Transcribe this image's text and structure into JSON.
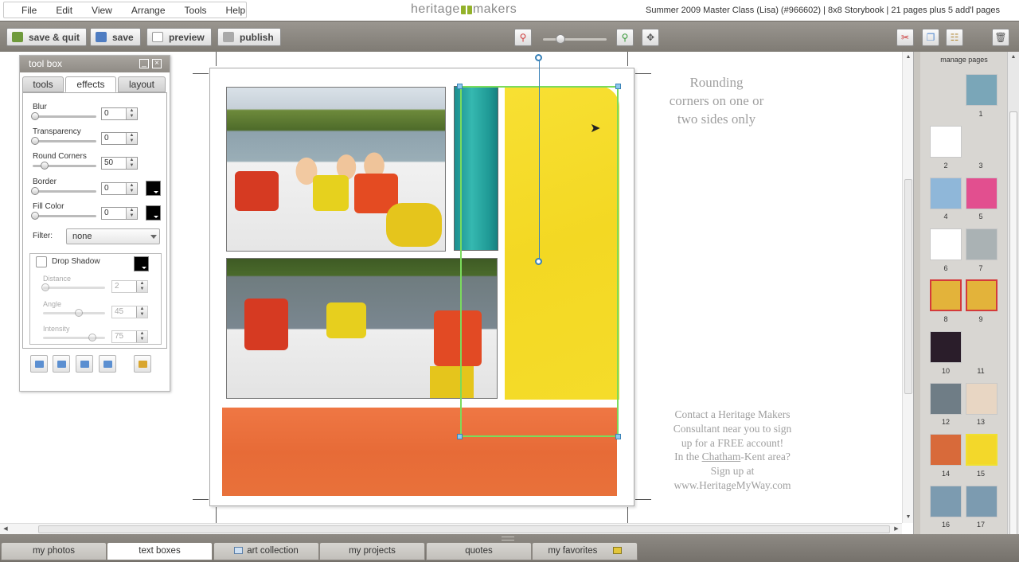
{
  "menu": {
    "items": [
      "File",
      "Edit",
      "View",
      "Arrange",
      "Tools",
      "Help"
    ]
  },
  "logo": {
    "left": "heritage",
    "right": "makers"
  },
  "project_info": "Summer 2009 Master Class (Lisa) (#966602) | 8x8 Storybook | 21 pages plus 5 add'l pages",
  "toolbar": {
    "save_quit": "save & quit",
    "save": "save",
    "preview": "preview",
    "publish": "publish"
  },
  "toolbox": {
    "title": "tool box",
    "tabs": [
      "tools",
      "effects",
      "layout"
    ],
    "active_tab": "effects",
    "blur": {
      "label": "Blur",
      "value": "0"
    },
    "transparency": {
      "label": "Transparency",
      "value": "0"
    },
    "round_corners": {
      "label": "Round Corners",
      "value": "50"
    },
    "border": {
      "label": "Border",
      "value": "0",
      "color": "#000000"
    },
    "fill_color": {
      "label": "Fill Color",
      "value": "0",
      "color": "#000000"
    },
    "filter": {
      "label": "Filter:",
      "value": "none"
    },
    "drop_shadow": {
      "label": "Drop Shadow",
      "checked": false,
      "distance": {
        "label": "Distance",
        "value": "2"
      },
      "angle": {
        "label": "Angle",
        "value": "45"
      },
      "intensity": {
        "label": "Intensity",
        "value": "75"
      }
    }
  },
  "canvas": {
    "note1": "Rounding corners on one or two sides only",
    "note2_lines": [
      "Contact a Heritage Makers",
      "Consultant near you to sign",
      "up for a FREE account!",
      "In the ",
      "Chatham",
      "-Kent area?",
      "Sign up at",
      "www.HeritageMyWay.com"
    ]
  },
  "pages_panel": {
    "title": "manage pages",
    "numbers": [
      "1",
      "2",
      "3",
      "4",
      "5",
      "6",
      "7",
      "8",
      "9",
      "10",
      "11",
      "12",
      "13",
      "14",
      "15",
      "16",
      "17"
    ]
  },
  "bottom_tabs": [
    "my photos",
    "text boxes",
    "art collection",
    "my projects",
    "quotes",
    "my favorites"
  ],
  "active_bottom_tab": "text boxes"
}
